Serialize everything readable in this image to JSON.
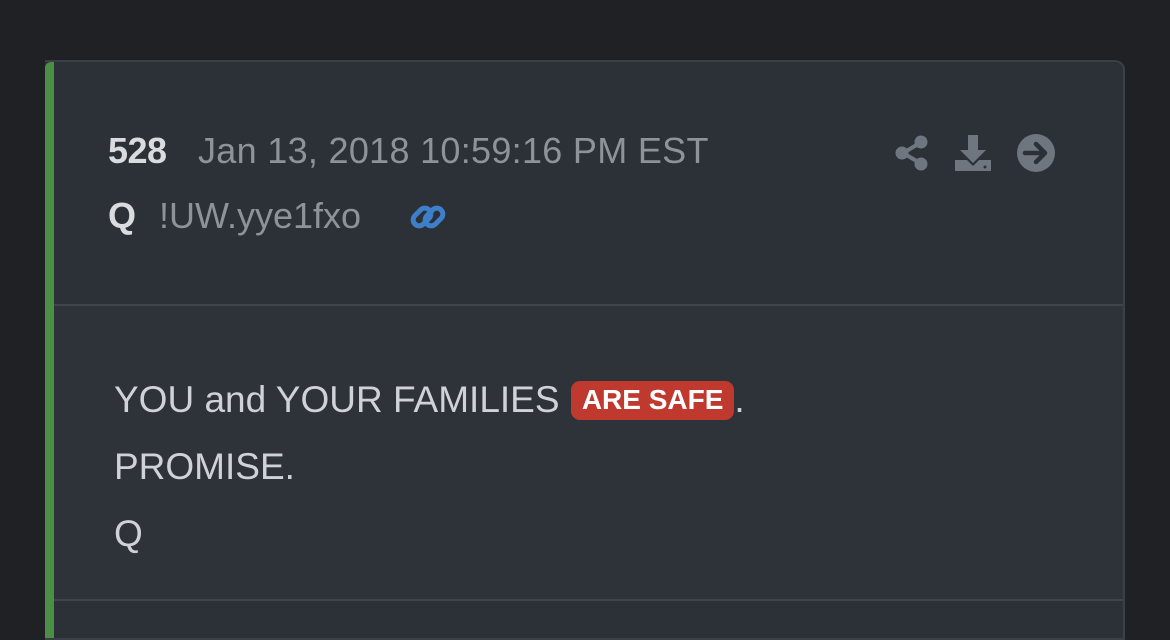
{
  "post": {
    "number": "528",
    "timestamp": "Jan 13, 2018 10:59:16 PM EST",
    "author": "Q",
    "tripcode": "!UW.yye1fxo",
    "body": {
      "line1_before": "YOU and YOUR FAMILIES ",
      "line1_highlight": "ARE SAFE",
      "line1_after": ".",
      "line2": "PROMISE.",
      "line3": "Q"
    }
  },
  "icons": {
    "link": "link-icon",
    "share": "share-icon",
    "download": "download-icon",
    "goto": "arrow-circle-right-icon"
  },
  "colors": {
    "page_background": "#1f2125",
    "card_background": "#2c3037",
    "accent_green": "#4a8f45",
    "highlight_red": "#c0392e",
    "link_blue": "#3d7fc9",
    "muted_icon": "#707680"
  }
}
